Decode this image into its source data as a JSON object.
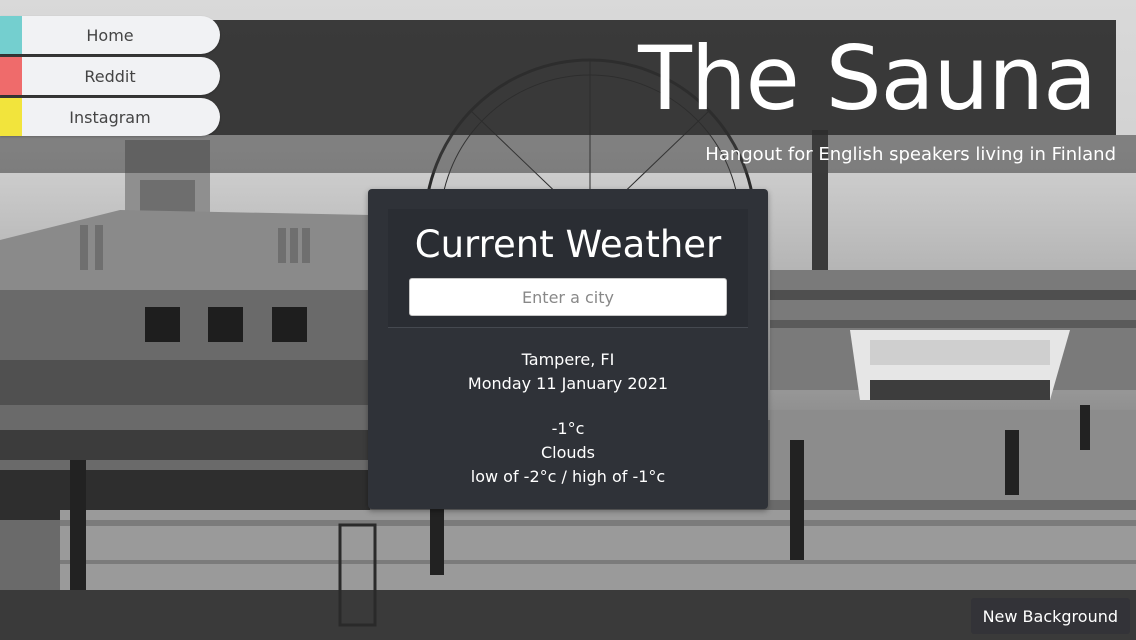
{
  "nav": {
    "items": [
      {
        "label": "Home",
        "color": "#74cfcf"
      },
      {
        "label": "Reddit",
        "color": "#ef6b6b"
      },
      {
        "label": "Instagram",
        "color": "#f2e43c"
      }
    ]
  },
  "header": {
    "title": "The Sauna",
    "tagline": "Hangout for English speakers living in Finland"
  },
  "weather": {
    "title": "Current Weather",
    "city_placeholder": "Enter a city",
    "location": "Tampere, FI",
    "date": "Monday 11 January 2021",
    "temperature": "-1°c",
    "condition": "Clouds",
    "range": "low of -2°c / high of -1°c"
  },
  "footer": {
    "new_background_label": "New Background"
  },
  "colors": {
    "header_band": "#2d2d2d",
    "card_bg": "#2f3238",
    "nav_bg": "#f1f2f4"
  }
}
